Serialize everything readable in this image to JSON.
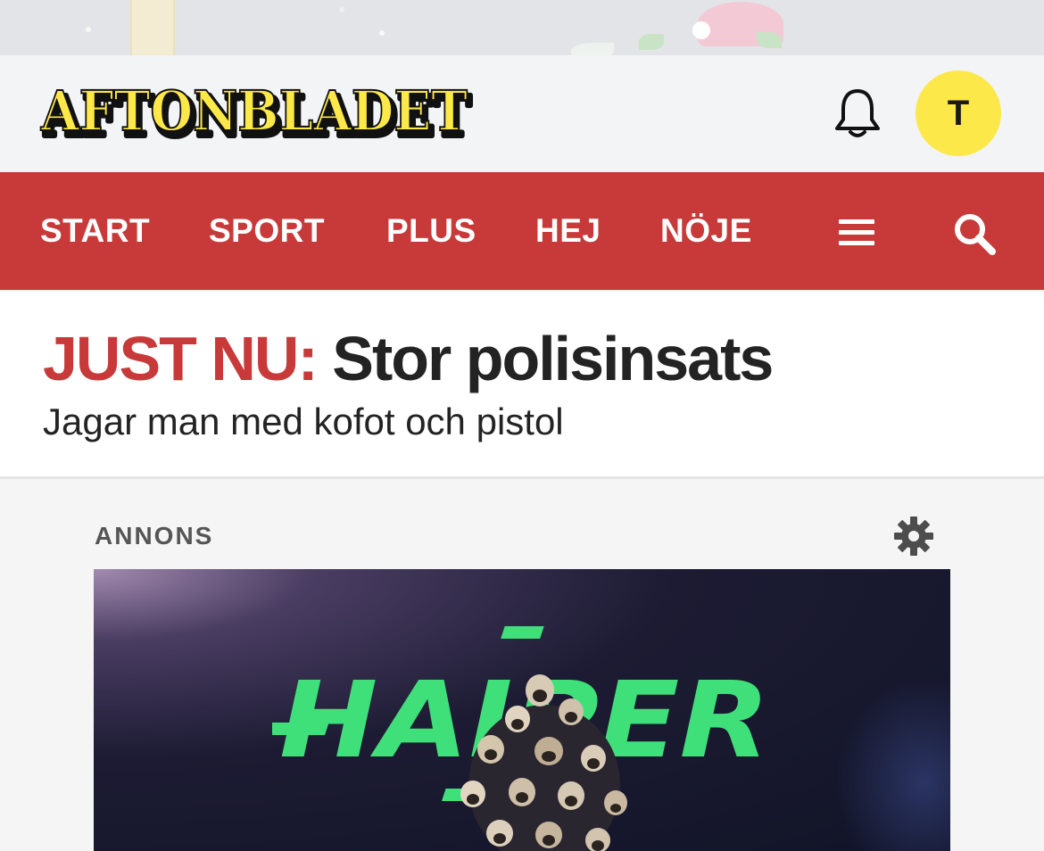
{
  "header": {
    "logo_text": "AFTONBLADET",
    "avatar_initial": "T",
    "colors": {
      "logo_yellow": "#fde84a",
      "avatar_bg": "#fde84a"
    }
  },
  "nav": {
    "items": [
      {
        "label": "START"
      },
      {
        "label": "SPORT"
      },
      {
        "label": "PLUS"
      },
      {
        "label": "HEJ"
      },
      {
        "label": "NÖJE"
      }
    ],
    "menu_icon": "hamburger-menu-icon",
    "search_icon": "search-icon",
    "colors": {
      "background": "#c83a3a",
      "text": "#ffffff"
    }
  },
  "breaking": {
    "label": "JUST NU:",
    "title": "Stor polisinsats",
    "subtitle": "Jagar man med kofot och pistol",
    "colors": {
      "label": "#c83a3a",
      "title": "#232323"
    }
  },
  "ad": {
    "label": "ANNONS",
    "settings_icon": "gear-icon",
    "brand_text": "HAIPER",
    "colors": {
      "brand": "#3fe07a"
    }
  }
}
